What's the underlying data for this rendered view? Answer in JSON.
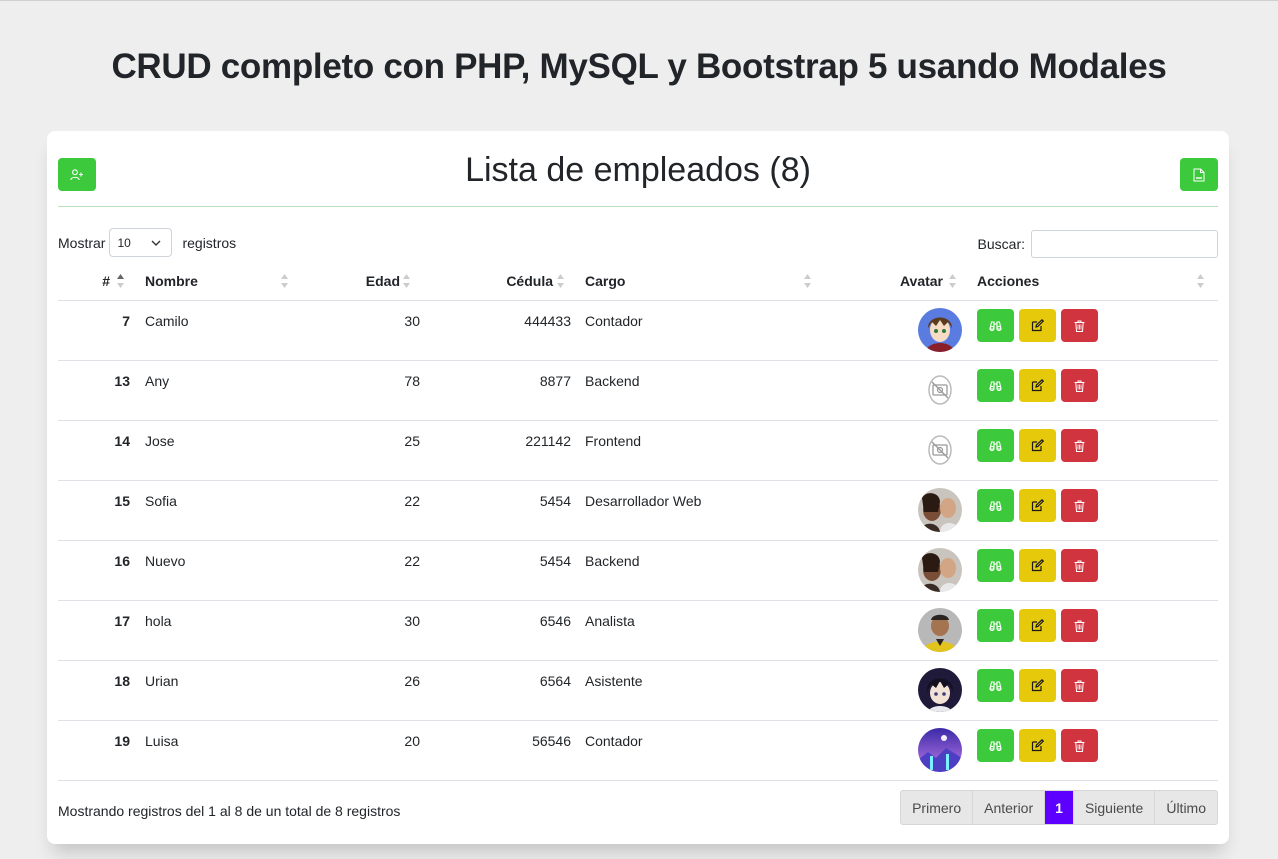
{
  "page": {
    "title": "CRUD completo con PHP, MySQL y Bootstrap 5 usando Modales"
  },
  "card": {
    "title": "Lista de empleados (8)",
    "add_icon": "user-plus-icon",
    "export_icon": "csv-file-icon"
  },
  "controls": {
    "show_label": "Mostrar",
    "show_value": "10",
    "records_label": "registros",
    "search_label": "Buscar:",
    "search_value": ""
  },
  "table": {
    "columns": [
      "#",
      "Nombre",
      "Edad",
      "Cédula",
      "Cargo",
      "Avatar",
      "Acciones"
    ],
    "rows": [
      {
        "id": "7",
        "nombre": "Camilo",
        "edad": "30",
        "cedula": "444433",
        "cargo": "Contador",
        "avatar": "anime-avatar"
      },
      {
        "id": "13",
        "nombre": "Any",
        "edad": "78",
        "cedula": "8877",
        "cargo": "Backend",
        "avatar": "no-image"
      },
      {
        "id": "14",
        "nombre": "Jose",
        "edad": "25",
        "cedula": "221142",
        "cargo": "Frontend",
        "avatar": "no-image"
      },
      {
        "id": "15",
        "nombre": "Sofia",
        "edad": "22",
        "cedula": "5454",
        "cargo": "Desarrollador Web",
        "avatar": "photo-couple"
      },
      {
        "id": "16",
        "nombre": "Nuevo",
        "edad": "22",
        "cedula": "5454",
        "cargo": "Backend",
        "avatar": "photo-couple"
      },
      {
        "id": "17",
        "nombre": "hola",
        "edad": "30",
        "cedula": "6546",
        "cargo": "Analista",
        "avatar": "photo-man-yellow"
      },
      {
        "id": "18",
        "nombre": "Urian",
        "edad": "26",
        "cedula": "6564",
        "cargo": "Asistente",
        "avatar": "anime-boy"
      },
      {
        "id": "19",
        "nombre": "Luisa",
        "edad": "20",
        "cedula": "56546",
        "cargo": "Contador",
        "avatar": "purple-landscape"
      }
    ],
    "action_icons": [
      "binoculars-icon",
      "edit-icon",
      "trash-icon"
    ]
  },
  "footer": {
    "info": "Mostrando registros del 1 al 8 de un total de 8 registros",
    "pagination": [
      "Primero",
      "Anterior",
      "1",
      "Siguiente",
      "Último"
    ]
  },
  "colors": {
    "green": "#3cca3c",
    "yellow": "#e7c90b",
    "red": "#d0343f",
    "active_page": "#5d00ff"
  }
}
